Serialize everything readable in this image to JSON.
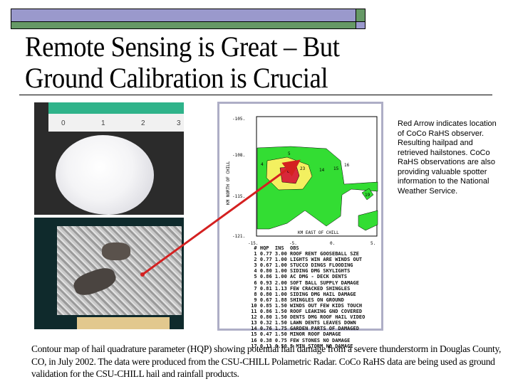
{
  "slide": {
    "title_line1": "Remote Sensing is Great – But",
    "title_line2": "Ground Calibration is Crucial",
    "colors": {
      "bar_purple": "#9a99cc",
      "bar_green": "#669966",
      "arrow": "#d42020"
    }
  },
  "photos": {
    "hailstone_ruler_labels": [
      "0",
      "1",
      "2",
      "3"
    ]
  },
  "map": {
    "y_axis_label": "KM NORTH OF CHILL",
    "x_axis_label": "KM EAST OF CHILL",
    "y_ticks": [
      "-105.",
      "-108.",
      "-115.",
      "-121."
    ],
    "x_ticks": [
      "-15.",
      "-5.",
      "0.",
      "5."
    ],
    "contour_labels": [
      "5",
      "4",
      "6",
      "23",
      "14",
      "16",
      "15",
      "19"
    ],
    "table_header": [
      "#",
      "HQP",
      "INS",
      "OBS"
    ],
    "table_rows": [
      [
        "1",
        "0.77",
        "3.00",
        "ROOF RENT GOOSEBALL SZE"
      ],
      [
        "2",
        "0.77",
        "1.00",
        "LIGHTS WIN ARE WINDS OUT"
      ],
      [
        "3",
        "0.67",
        "1.00",
        "STUCCO DINGS FLOODING"
      ],
      [
        "4",
        "0.80",
        "1.00",
        "SIDING DMG SKYLIGHTS"
      ],
      [
        "5",
        "0.86",
        "1.00",
        "AC DMG - DECK DENTS"
      ],
      [
        "6",
        "0.93",
        "2.00",
        "SOFT BALL SUPPLY DAMAGE"
      ],
      [
        "7",
        "0.81",
        "1.13",
        "FEW CRACKED SHINGLES"
      ],
      [
        "8",
        "0.80",
        "1.00",
        "SIDING DMG HAIL DAMAGE"
      ],
      [
        "9",
        "0.67",
        "1.88",
        "SHINGLES ON GROUND"
      ],
      [
        "10",
        "0.85",
        "1.50",
        "WINDS OUT FEW KIDS TOUCH"
      ],
      [
        "11",
        "0.86",
        "1.50",
        "ROOF LEAKING GND COVERED"
      ],
      [
        "12",
        "0.80",
        "1.50",
        "DENTS DMG ROOF HAIL VIDEO"
      ],
      [
        "13",
        "0.32",
        "1.50",
        "LAWN DENTS LEAVES DOWN"
      ],
      [
        "14",
        "0.76",
        "1.75",
        "GARDEN PARTS OF DAMAGED"
      ],
      [
        "15",
        "0.47",
        "1.50",
        "MINOR ROOF DAMAGE"
      ],
      [
        "16",
        "0.38",
        "0.75",
        "FEW STONES NO DAMAGE"
      ],
      [
        "17",
        "0.11",
        "0.50",
        "5 MIN STORM NO DAMAGE"
      ]
    ]
  },
  "side_caption": "Red Arrow indicates location of  CoCo RaHS observer. Resulting hailpad and retrieved hailstones. CoCo RaHS observations are also providing valuable spotter information to the National Weather Service.",
  "bottom_caption": "Contour map of hail quadrature parameter (HQP) showing potential hail damage from a severe thunderstorm in Douglas County, CO, in July 2002. The data were produced from the CSU-CHILL Polametric Radar. CoCo RaHS data are being used as ground validation for the CSU-CHILL hail and rainfall products."
}
